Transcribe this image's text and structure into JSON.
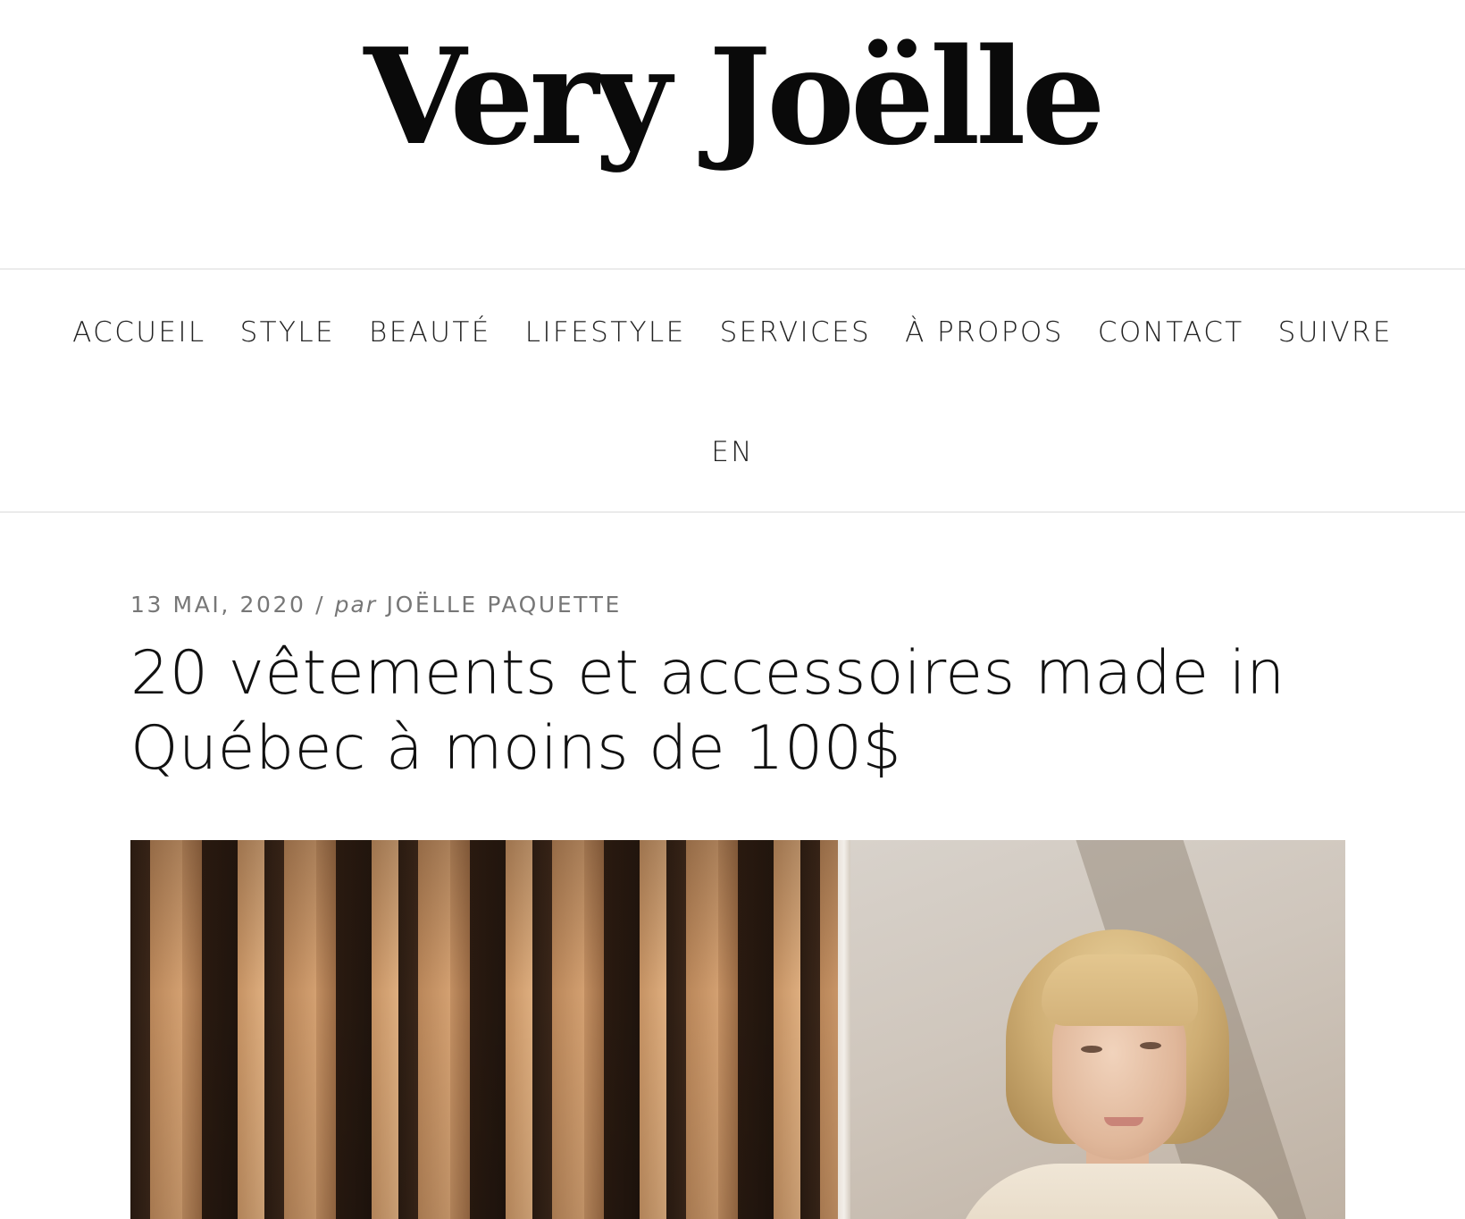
{
  "site": {
    "logo_text": "Very Joëlle"
  },
  "nav": {
    "items": [
      {
        "label": "ACCUEIL"
      },
      {
        "label": "STYLE"
      },
      {
        "label": "BEAUTÉ"
      },
      {
        "label": "LIFESTYLE"
      },
      {
        "label": "SERVICES"
      },
      {
        "label": "À PROPOS"
      },
      {
        "label": "CONTACT"
      },
      {
        "label": "SUIVRE"
      }
    ],
    "language": "EN"
  },
  "article": {
    "date": "13 MAI, 2020",
    "separator": "/",
    "by": "par",
    "author": "JOËLLE PAQUETTE",
    "title": "20 vêtements et accessoires made in Québec à moins de 100$"
  },
  "colors": {
    "text": "#1a1a1a",
    "meta": "#777777",
    "divider": "#ebebeb",
    "background": "#ffffff"
  }
}
